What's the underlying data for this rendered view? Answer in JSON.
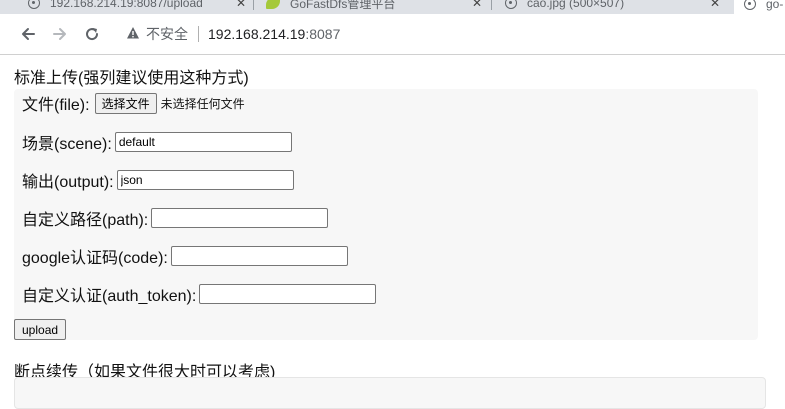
{
  "browser": {
    "tabs": [
      {
        "title": "192.168.214.19:8087/upload",
        "favicon": "globe-icon"
      },
      {
        "title": "GoFastDfs管理平台",
        "favicon": "leaf-icon"
      },
      {
        "title": "cao.jpg (500×507)",
        "favicon": "globe-icon"
      },
      {
        "title": "go-",
        "favicon": "globe-icon"
      }
    ],
    "security_label": "不安全",
    "url_host": "192.168.214.19",
    "url_port": ":8087"
  },
  "standard_upload": {
    "title": "标准上传(强列建议使用这种方式)",
    "file_label": "文件(file):",
    "choose_file_button": "选择文件",
    "no_file_text": "未选择任何文件",
    "scene_label": "场景(scene):",
    "scene_value": "default",
    "output_label": "输出(output):",
    "output_value": "json",
    "path_label": "自定义路径(path):",
    "path_value": "",
    "code_label": "google认证码(code):",
    "code_value": "",
    "auth_label": "自定义认证(auth_token):",
    "auth_value": "",
    "upload_button": "upload"
  },
  "resume_upload": {
    "title": "断点续传（如果文件很大时可以考虑)"
  }
}
